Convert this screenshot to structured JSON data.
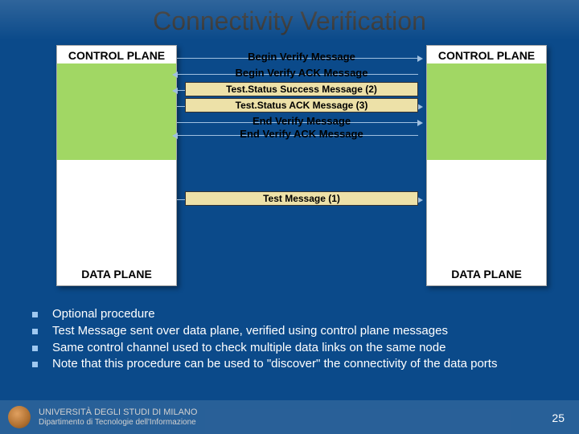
{
  "title": "Connectivity Verification",
  "planes": {
    "controlLabel": "CONTROL PLANE",
    "dataLabel": "DATA PLANE"
  },
  "messages": {
    "beginVerify": "Begin Verify Message",
    "beginVerifyAck": "Begin Verify ACK Message",
    "testStatusSuccess": "Test.Status Success Message (2)",
    "testStatusAck": "Test.Status ACK Message (3)",
    "endVerify": "End Verify Message",
    "endVerifyAck": "End Verify ACK Message",
    "testMessage": "Test Message (1)"
  },
  "bullets": [
    "Optional procedure",
    "Test Message sent over data plane, verified using control plane messages",
    "Same control channel used to check multiple data links on the same node",
    "Note that this procedure can be used to \"discover\" the connectivity of the data ports"
  ],
  "footer": {
    "line1": "UNIVERSITÀ DEGLI STUDI DI MILANO",
    "line2": "Dipartimento di Tecnologie dell'Informazione"
  },
  "pageNumber": "25"
}
